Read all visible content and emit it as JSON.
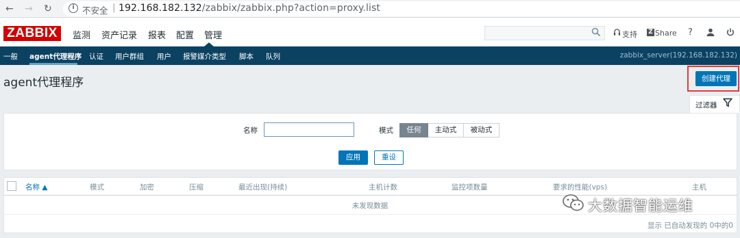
{
  "browser": {
    "back_icon": "arrow-left",
    "forward_icon": "arrow-right",
    "reload_icon": "reload",
    "security_label": "不安全",
    "url_host": "192.168.182.132",
    "url_path": "/zabbix/zabbix.php?action=proxy.list"
  },
  "header": {
    "logo": "ZABBIX",
    "menu": [
      "监测",
      "资产记录",
      "报表",
      "配置",
      "管理"
    ],
    "active_menu": "管理",
    "search_placeholder": "",
    "support_label": "支持",
    "share_label": "Share",
    "help_label": "?",
    "user_icon": "user",
    "power_icon": "power"
  },
  "submenu": {
    "items": [
      "一般",
      "agent代理程序",
      "认证",
      "用户群组",
      "用户",
      "报警媒介类型",
      "脚本",
      "队列"
    ],
    "active": "agent代理程序",
    "server": "zabbix_server(192.168.182.132)"
  },
  "page": {
    "title": "agent代理程序",
    "create_button": "创建代理",
    "filter_tab": "过滤器"
  },
  "filter": {
    "name_label": "名称",
    "name_value": "",
    "mode_label": "模式",
    "mode_options": [
      "任何",
      "主动式",
      "被动式"
    ],
    "mode_selected": "任何",
    "apply_label": "应用",
    "reset_label": "重设"
  },
  "table": {
    "columns": [
      "名称 ▲",
      "模式",
      "加密",
      "压缩",
      "最近出现(持续)",
      "主机计数",
      "监控项数量",
      "要求的性能(vps)",
      "主机"
    ],
    "sorted_column": "名称",
    "empty_text": "未发现数据",
    "footer": "显示 已自动发现的 0中的0"
  },
  "watermark": {
    "text": "大数据智能运维"
  },
  "colors": {
    "brand_red": "#d40000",
    "nav_blue": "#0b4262",
    "primary_button": "#0275b8",
    "highlight": "#e53935"
  }
}
